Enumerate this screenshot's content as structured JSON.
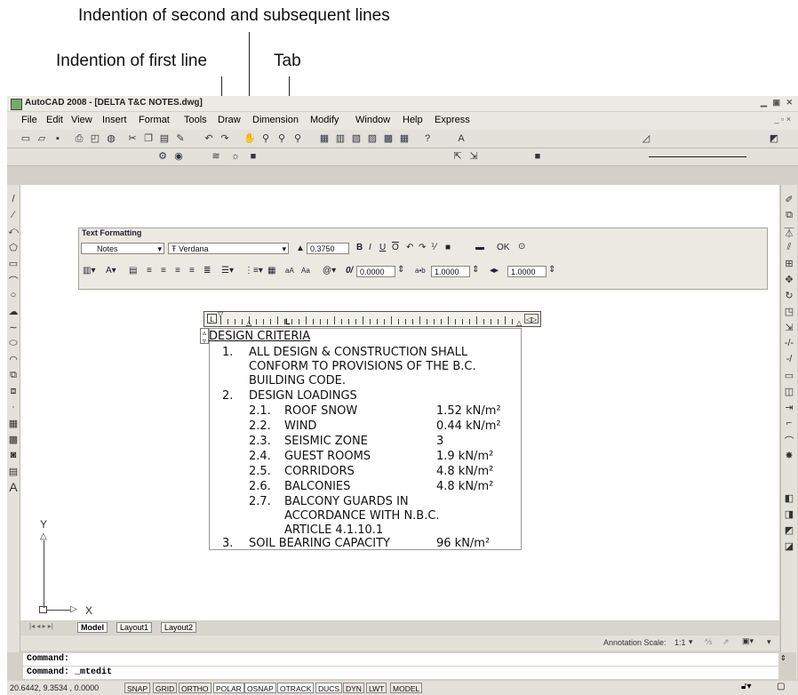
{
  "callouts": {
    "second_lines": "Indention of second and subsequent lines",
    "first_line": "Indention of first line",
    "tab": "Tab"
  },
  "window": {
    "title": "AutoCAD 2008 - [DELTA T&C NOTES.dwg]"
  },
  "menu": [
    "File",
    "Edit",
    "View",
    "Insert",
    "Format",
    "Tools",
    "Draw",
    "Dimension",
    "Modify",
    "Window",
    "Help",
    "Express"
  ],
  "text_formatting": {
    "title": "Text Formatting",
    "style": "Notes",
    "font": "Verdana",
    "height": "0.3750",
    "ok_label": "OK",
    "oblique": "0.0000",
    "tracking": "1.0000",
    "width_factor": "1.0000"
  },
  "mtext": {
    "heading": "DESIGN CRITERIA",
    "item1_num": "1.",
    "item1_l1": "ALL DESIGN & CONSTRUCTION SHALL",
    "item1_l2": "CONFORM TO PROVISIONS OF THE B.C.",
    "item1_l3": "BUILDING CODE.",
    "item2_num": "2.",
    "item2_label": "DESIGN LOADINGS",
    "loads": [
      {
        "num": "2.1.",
        "name": "ROOF SNOW",
        "value": "1.52 kN/m²"
      },
      {
        "num": "2.2.",
        "name": "WIND",
        "value": "0.44 kN/m²"
      },
      {
        "num": "2.3.",
        "name": "SEISMIC ZONE",
        "value": "3"
      },
      {
        "num": "2.4.",
        "name": "GUEST ROOMS",
        "value": "1.9 kN/m²"
      },
      {
        "num": "2.5.",
        "name": "CORRIDORS",
        "value": "4.8 kN/m²"
      },
      {
        "num": "2.6.",
        "name": "BALCONIES",
        "value": "4.8 kN/m²"
      }
    ],
    "item27_num": "2.7.",
    "item27_l1": "BALCONY GUARDS IN",
    "item27_l2": "ACCORDANCE WITH N.B.C.",
    "item27_l3": "ARTICLE 4.1.10.1",
    "item3_num": "3.",
    "item3_name": "SOIL BEARING CAPACITY",
    "item3_value": "96 kN/m²"
  },
  "ucs": {
    "y": "Y",
    "x": "X"
  },
  "layout_tabs": [
    "Model",
    "Layout1",
    "Layout2"
  ],
  "annotation_scale": {
    "label": "Annotation Scale:",
    "value": "1:1"
  },
  "command": {
    "line1": "Command:",
    "line2": "Command: _mtedit"
  },
  "status": {
    "coords": "20.6442, 9.3534 , 0.0000",
    "toggles": [
      "SNAP",
      "GRID",
      "ORTHO",
      "POLAR",
      "OSNAP",
      "OTRACK",
      "DUCS",
      "DYN",
      "LWT",
      "MODEL"
    ]
  }
}
